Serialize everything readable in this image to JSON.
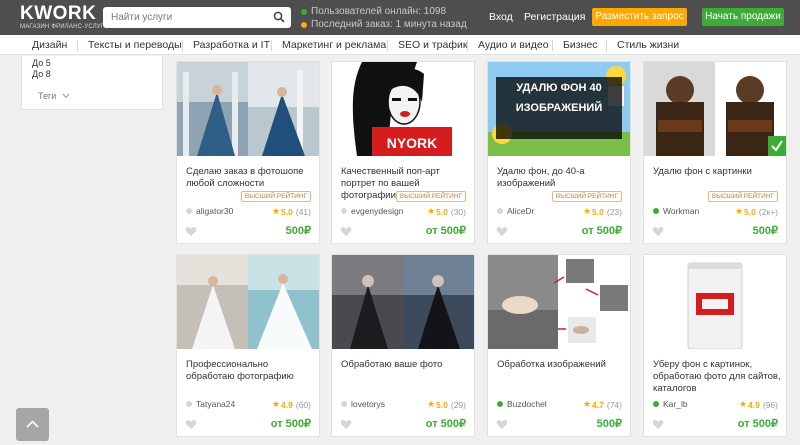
{
  "header": {
    "logo": "KWORK",
    "logo_sub": "МАГАЗИН ФРИЛАНС-УСЛУГ",
    "search_placeholder": "Найти услуги",
    "stats_online": "Пользователей онлайн: 1098",
    "stats_last_order": "Последний заказ: 1 минута назад",
    "login": "Вход",
    "register": "Регистрация",
    "post_request": "Разместить запрос",
    "start_selling": "Начать продажи"
  },
  "categories": [
    "Дизайн",
    "Тексты и переводы",
    "Разработка и IT",
    "Маркетинг и реклама",
    "SEO и трафик",
    "Аудио и видео",
    "Бизнес",
    "Стиль жизни"
  ],
  "sidebar": {
    "items": [
      "До 5",
      "До 8"
    ],
    "tags": "Теги"
  },
  "cards": [
    {
      "title": "Сделаю заказ в фотошопе любой сложности",
      "badge": "ВЫСШИЙ РЕЙТИНГ",
      "seller": "aligator30",
      "online": false,
      "rating": "5.0",
      "count": "(41)",
      "price": "500₽"
    },
    {
      "title": "Качественный поп-арт портрет по вашей фотографии",
      "badge": "ВЫСШИЙ РЕЙТИНГ",
      "seller": "evgenydesign",
      "online": false,
      "rating": "5.0",
      "count": "(30)",
      "price": "от 500₽"
    },
    {
      "title": "Удалю фон, до 40-а изображений",
      "badge": "ВЫСШИЙ РЕЙТИНГ",
      "seller": "AliceDr",
      "online": false,
      "rating": "5.0",
      "count": "(23)",
      "price": "от 500₽",
      "image_text": "УДАЛЮ ФОН 40 ИЗОБРАЖЕНИЙ"
    },
    {
      "title": "Удалю фон с картинки",
      "badge": "ВЫСШИЙ РЕЙТИНГ",
      "seller": "Workman",
      "online": true,
      "rating": "5.0",
      "count": "(2к+)",
      "price": "500₽"
    },
    {
      "title": "Профессионально обработаю фотографию",
      "badge": "",
      "seller": "Tatyana24",
      "online": false,
      "rating": "4.9",
      "count": "(60)",
      "price": "от 500₽"
    },
    {
      "title": "Обработаю ваше фото",
      "badge": "",
      "seller": "lovetorys",
      "online": false,
      "rating": "5.0",
      "count": "(29)",
      "price": "от 500₽"
    },
    {
      "title": "Обработка изображений",
      "badge": "",
      "seller": "Buzdochel",
      "online": true,
      "rating": "4.7",
      "count": "(74)",
      "price": "500₽"
    },
    {
      "title": "Уберу фон с картинок, обработаю фото для сайтов, каталогов",
      "badge": "",
      "seller": "Kar_lb",
      "online": true,
      "rating": "4.9",
      "count": "(96)",
      "price": "от 500₽"
    }
  ],
  "colors": {
    "accent_orange": "#ffa800",
    "accent_green": "#3dac37",
    "header_bg": "#4e4e4e",
    "online_dot": "#3dac37",
    "stat_dot_green": "#3dac37",
    "stat_dot_orange": "#ffa800"
  }
}
